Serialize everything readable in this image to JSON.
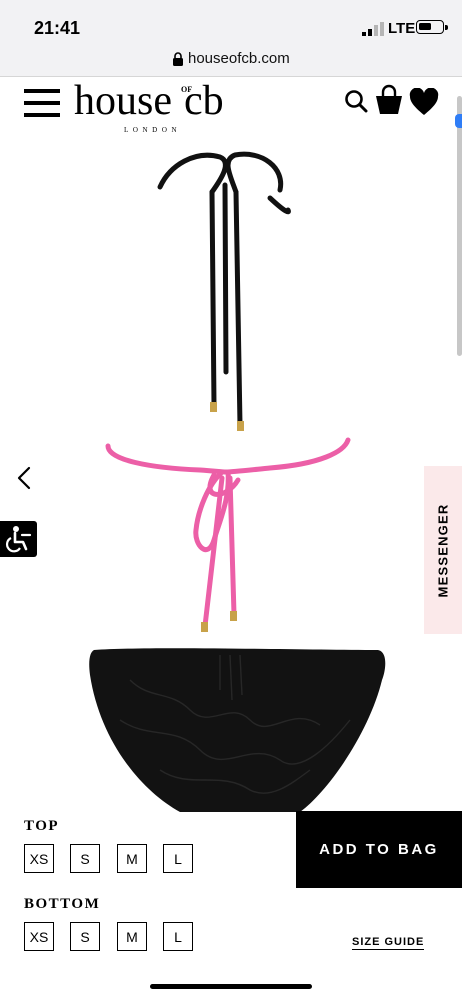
{
  "status_bar": {
    "time": "21:41",
    "network": "LTE",
    "icons": [
      "signal-icon",
      "battery-icon"
    ]
  },
  "browser": {
    "url": "houseofcb.com",
    "icons": [
      "lock-icon"
    ]
  },
  "header": {
    "logo_main": "house",
    "logo_of": "OF",
    "logo_cb": "cb",
    "logo_sub": "LONDON",
    "icons": [
      "menu-icon",
      "search-icon",
      "shopping-bag-icon",
      "heart-icon"
    ]
  },
  "gallery": {
    "icons": [
      "chevron-left-icon",
      "accessibility-icon"
    ],
    "messenger_label": "MESSENGER"
  },
  "colors": {
    "accent_pink": "#ec5fa7",
    "messenger_bg": "#fbe9ea",
    "primary": "#000000"
  },
  "product": {
    "top_label": "TOP",
    "top_sizes": [
      "XS",
      "S",
      "M",
      "L"
    ],
    "bottom_label": "BOTTOM",
    "bottom_sizes": [
      "XS",
      "S",
      "M",
      "L"
    ],
    "add_to_bag": "ADD TO BAG",
    "size_guide": "SIZE GUIDE"
  }
}
